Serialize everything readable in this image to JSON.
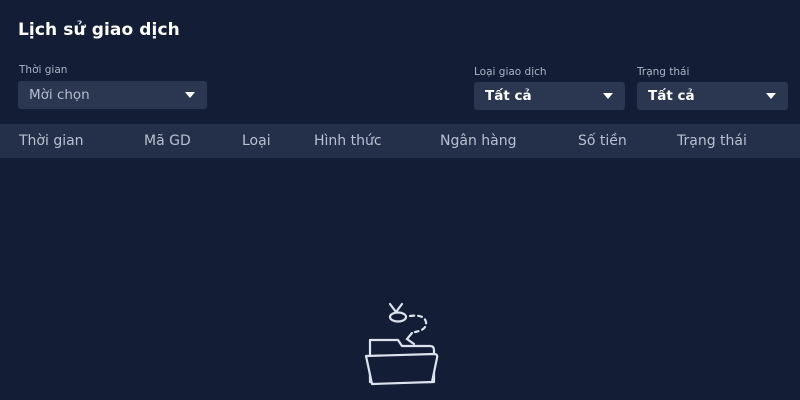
{
  "page": {
    "title": "Lịch sử giao dịch"
  },
  "filters": {
    "time": {
      "label": "Thời gian",
      "placeholder": "Mời chọn"
    },
    "type": {
      "label": "Loại giao dịch",
      "value": "Tất cả"
    },
    "status": {
      "label": "Trạng thái",
      "value": "Tất cả"
    }
  },
  "table": {
    "columns": [
      "Thời gian",
      "Mã GD",
      "Loại",
      "Hình thức",
      "Ngân hàng",
      "Số tiền",
      "Trạng thái"
    ],
    "rows": []
  },
  "empty_state": {
    "icon": "empty-folder-icon"
  },
  "colors": {
    "background": "#131e36",
    "input": "#2b3750",
    "header": "#243049"
  }
}
